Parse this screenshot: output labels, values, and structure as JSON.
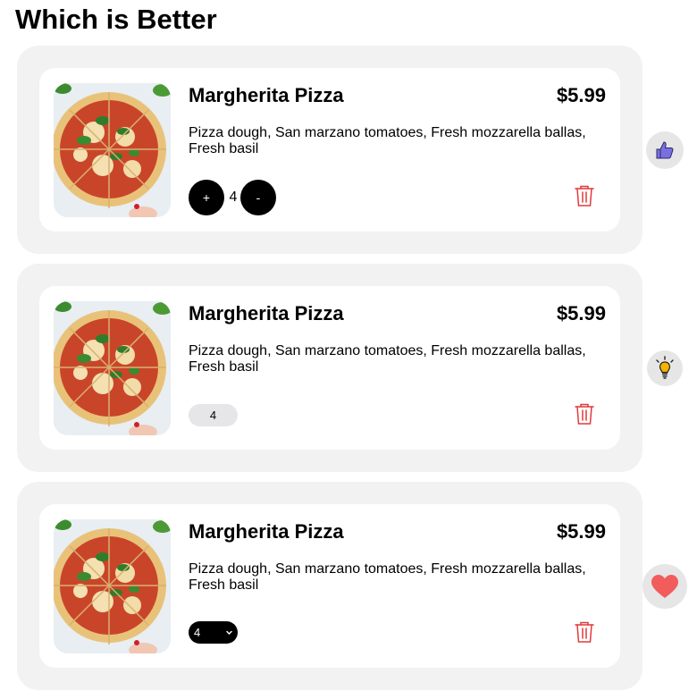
{
  "page": {
    "title": "Which is Better"
  },
  "cards": [
    {
      "name": "Margherita Pizza",
      "price": "$5.99",
      "description": "Pizza dough, San marzano tomatoes, Fresh mozzarella ballas, Fresh basil",
      "quantity": "4",
      "plus_label": "+",
      "minus_label": "-",
      "control": "round-buttons",
      "side_icon": "thumbs-up-icon"
    },
    {
      "name": "Margherita Pizza",
      "price": "$5.99",
      "description": "Pizza dough, San marzano tomatoes, Fresh mozzarella ballas, Fresh basil",
      "quantity": "4",
      "control": "pill-input",
      "side_icon": "lightbulb-icon"
    },
    {
      "name": "Margherita Pizza",
      "price": "$5.99",
      "description": "Pizza dough, San marzano tomatoes, Fresh mozzarella ballas, Fresh basil",
      "quantity": "4",
      "control": "select",
      "side_icon": "heart-icon"
    }
  ],
  "colors": {
    "card_outer": "#f2f2f2",
    "card_inner": "#ffffff",
    "trash_icon": "#e03a3a",
    "thumbs_up": "#7b6fe0",
    "lightbulb": "#f5b400",
    "heart": "#f25c5c",
    "button": "#000000",
    "pill": "#e6e6e9"
  }
}
